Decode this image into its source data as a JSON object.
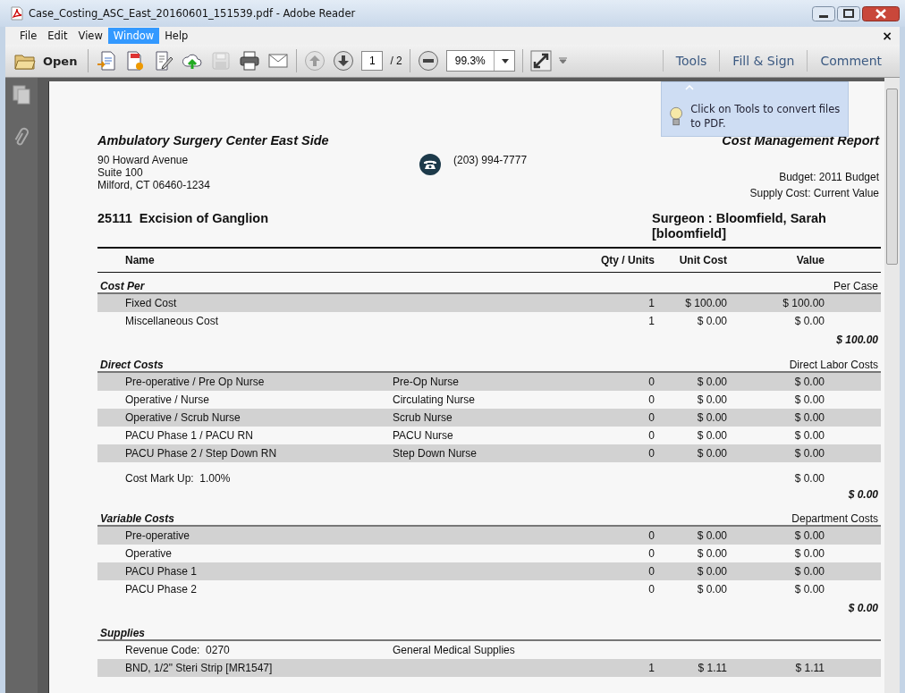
{
  "window": {
    "title": "Case_Costing_ASC_East_20160601_151539.pdf - Adobe Reader"
  },
  "menu_bar": {
    "items": [
      {
        "label": "File",
        "selected": false
      },
      {
        "label": "Edit",
        "selected": false
      },
      {
        "label": "View",
        "selected": false
      },
      {
        "label": "Window",
        "selected": true
      },
      {
        "label": "Help",
        "selected": false
      }
    ],
    "close": "×"
  },
  "toolbar": {
    "open": "Open",
    "file_buttons": [
      {
        "disabled": false
      },
      {
        "disabled": false
      },
      {
        "disabled": false
      },
      {
        "disabled": false
      },
      {
        "disabled": true
      },
      {
        "disabled": false
      },
      {
        "disabled": false
      }
    ],
    "page_nav": [
      {
        "disabled": true
      },
      {
        "disabled": false
      }
    ],
    "page": "1",
    "page_count": "/ 2",
    "zoom": "99.3%",
    "panes": [
      "Tools",
      "Fill & Sign",
      "Comment"
    ]
  },
  "tooltip": {
    "text": "Click on Tools to convert files to PDF."
  },
  "report": {
    "organization": "Ambulatory Surgery Center East Side",
    "title": "Cost Management Report",
    "address": [
      "90 Howard Avenue",
      "Suite 100",
      "Milford, CT 06460-1234"
    ],
    "phone": "(203) 994-7777",
    "settings": [
      "Budget: 2011 Budget",
      "Supply Cost: Current Value"
    ],
    "procedure": "25111  Excision of Ganglion",
    "surgeon": "Surgeon : Bloomfield, Sarah [bloomfield]",
    "columns": [
      "Name",
      "Qty / Units",
      "Unit Cost",
      "Value"
    ],
    "sections": [
      {
        "title": "Cost Per",
        "note": "Per Case",
        "rows": [
          {
            "kind": "item",
            "name": "Fixed Cost",
            "qty": "1",
            "unit_cost": "$ 100.00",
            "value": "$ 100.00"
          },
          {
            "kind": "item",
            "name": "Miscellaneous Cost",
            "qty": "1",
            "unit_cost": "$ 0.00",
            "value": "$ 0.00"
          }
        ],
        "total": "$ 100.00"
      },
      {
        "title": "Direct Costs",
        "note": "Direct Labor Costs",
        "rows": [
          {
            "kind": "item",
            "name": "Pre-operative / Pre Op Nurse",
            "detail": "Pre-Op Nurse",
            "qty": "0",
            "unit_cost": "$ 0.00",
            "value": "$ 0.00"
          },
          {
            "kind": "item",
            "name": "Operative / Nurse",
            "detail": "Circulating Nurse",
            "qty": "0",
            "unit_cost": "$ 0.00",
            "value": "$ 0.00"
          },
          {
            "kind": "item",
            "name": "Operative / Scrub Nurse",
            "detail": "Scrub Nurse",
            "qty": "0",
            "unit_cost": "$ 0.00",
            "value": "$ 0.00"
          },
          {
            "kind": "item",
            "name": "PACU Phase 1 / PACU RN",
            "detail": "PACU Nurse",
            "qty": "0",
            "unit_cost": "$ 0.00",
            "value": "$ 0.00"
          },
          {
            "kind": "item",
            "name": "PACU Phase 2 / Step Down RN",
            "detail": "Step Down Nurse",
            "qty": "0",
            "unit_cost": "$ 0.00",
            "value": "$ 0.00"
          },
          {
            "kind": "markup",
            "name": "Cost Mark Up:  1.00%",
            "value": "$ 0.00"
          }
        ],
        "total": "$ 0.00"
      },
      {
        "title": "Variable Costs",
        "note": "Department Costs",
        "rows": [
          {
            "kind": "item",
            "name": "Pre-operative",
            "qty": "0",
            "unit_cost": "$ 0.00",
            "value": "$ 0.00"
          },
          {
            "kind": "item",
            "name": "Operative",
            "qty": "0",
            "unit_cost": "$ 0.00",
            "value": "$ 0.00"
          },
          {
            "kind": "item",
            "name": "PACU Phase 1",
            "qty": "0",
            "unit_cost": "$ 0.00",
            "value": "$ 0.00"
          },
          {
            "kind": "item",
            "name": "PACU Phase 2",
            "qty": "0",
            "unit_cost": "$ 0.00",
            "value": "$ 0.00"
          }
        ],
        "total": "$ 0.00"
      },
      {
        "title": "Supplies",
        "rows": [
          {
            "kind": "subheading",
            "name": "Revenue Code:  0270",
            "detail": "General Medical Supplies"
          },
          {
            "kind": "item",
            "name": "BND, 1/2\" Steri Strip [MR1547]",
            "qty": "1",
            "unit_cost": "$ 1.11",
            "value": "$ 1.11"
          }
        ]
      }
    ]
  }
}
